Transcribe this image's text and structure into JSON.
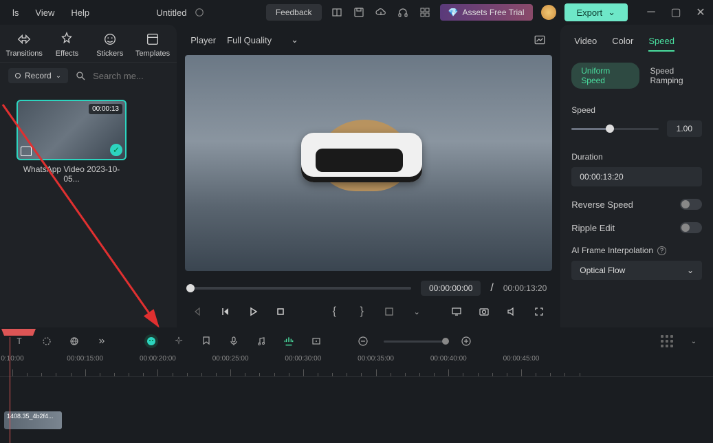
{
  "menu": {
    "tools": "ls",
    "view": "View",
    "help": "Help"
  },
  "title": "Untitled",
  "feedback": "Feedback",
  "assets": "Assets Free Trial",
  "export": "Export",
  "tabs": {
    "transitions": "Transitions",
    "effects": "Effects",
    "stickers": "Stickers",
    "templates": "Templates"
  },
  "record": "Record",
  "search_placeholder": "Search me...",
  "media": {
    "duration": "00:00:13",
    "label": "WhatsApp Video 2023-10-05..."
  },
  "player": {
    "label": "Player",
    "quality": "Full Quality",
    "time_current": "00:00:00:00",
    "time_sep": "/",
    "time_total": "00:00:13:20"
  },
  "rtabs": {
    "video": "Video",
    "color": "Color",
    "speed": "Speed"
  },
  "speed": {
    "uniform": "Uniform Speed",
    "ramping": "Speed Ramping",
    "speed_label": "Speed",
    "speed_value": "1.00",
    "duration_label": "Duration",
    "duration_value": "00:00:13:20",
    "reverse": "Reverse Speed",
    "ripple": "Ripple Edit",
    "ai_label": "AI Frame Interpolation",
    "ai_value": "Optical Flow"
  },
  "timeline": {
    "marks": [
      "0:10:00",
      "00:00:15:00",
      "00:00:20:00",
      "00:00:25:00",
      "00:00:30:00",
      "00:00:35:00",
      "00:00:40:00",
      "00:00:45:00"
    ],
    "clip": "1408.35_4b2f4..."
  }
}
